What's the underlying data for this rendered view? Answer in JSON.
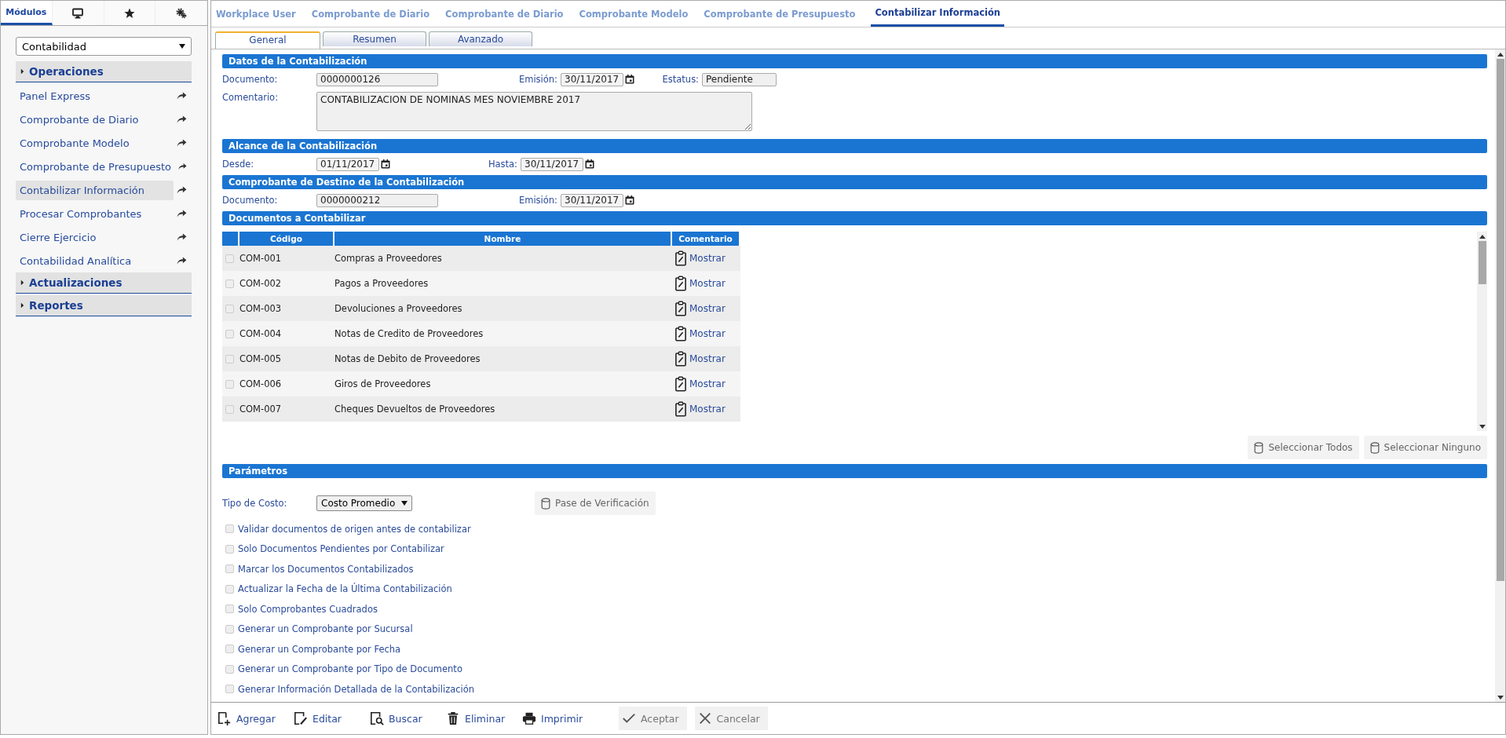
{
  "sidebar": {
    "tabs": [
      {
        "label": "Módulos",
        "selected": true
      },
      {
        "selected": false
      },
      {
        "selected": false
      },
      {
        "selected": false
      }
    ],
    "module_select": {
      "value": "Contabilidad"
    },
    "sections": [
      {
        "title": "Operaciones",
        "items": [
          {
            "label": "Panel Express",
            "selected": false
          },
          {
            "label": "Comprobante de Diario",
            "selected": false
          },
          {
            "label": "Comprobante Modelo",
            "selected": false
          },
          {
            "label": "Comprobante de Presupuesto",
            "selected": false
          },
          {
            "label": "Contabilizar Información",
            "selected": true
          },
          {
            "label": "Procesar Comprobantes",
            "selected": false
          },
          {
            "label": "Cierre Ejercicio",
            "selected": false
          },
          {
            "label": "Contabilidad Analítica",
            "selected": false
          }
        ]
      },
      {
        "title": "Actualizaciones"
      },
      {
        "title": "Reportes"
      }
    ]
  },
  "tabs": [
    {
      "label": "Workplace User",
      "selected": false
    },
    {
      "label": "Comprobante de Diario",
      "selected": false
    },
    {
      "label": "Comprobante de Diario",
      "selected": false
    },
    {
      "label": "Comprobante Modelo",
      "selected": false
    },
    {
      "label": "Comprobante de Presupuesto",
      "selected": false
    },
    {
      "label": "Contabilizar Información",
      "selected": true
    }
  ],
  "subtabs": [
    {
      "label": "General",
      "selected": true
    },
    {
      "label": "Resumen",
      "selected": false
    },
    {
      "label": "Avanzado",
      "selected": false
    }
  ],
  "datos": {
    "title": "Datos de la Contabilización",
    "documento": {
      "label": "Documento:",
      "value": "0000000126"
    },
    "emision": {
      "label": "Emisión:",
      "value": "30/11/2017"
    },
    "estatus": {
      "label": "Estatus:",
      "value": "Pendiente"
    },
    "comentario": {
      "label": "Comentario:",
      "value": "CONTABILIZACION DE NOMINAS MES NOVIEMBRE 2017"
    }
  },
  "alcance": {
    "title": "Alcance de la Contabilización",
    "desde": {
      "label": "Desde:",
      "value": "01/11/2017"
    },
    "hasta": {
      "label": "Hasta:",
      "value": "30/11/2017"
    }
  },
  "destino": {
    "title": "Comprobante de Destino de la Contabilización",
    "documento": {
      "label": "Documento:",
      "value": "0000000212"
    },
    "emision": {
      "label": "Emisión:",
      "value": "30/11/2017"
    }
  },
  "documentos": {
    "title": "Documentos a Contabilizar",
    "columns": [
      "Código",
      "Nombre",
      "Comentario"
    ],
    "rows": [
      {
        "checked": false,
        "code": "COM-001",
        "name": "Compras a Proveedores",
        "comment": "Mostrar"
      },
      {
        "checked": false,
        "code": "COM-002",
        "name": "Pagos a Proveedores",
        "comment": "Mostrar"
      },
      {
        "checked": false,
        "code": "COM-003",
        "name": "Devoluciones a Proveedores",
        "comment": "Mostrar"
      },
      {
        "checked": false,
        "code": "COM-004",
        "name": "Notas de Credito de Proveedores",
        "comment": "Mostrar"
      },
      {
        "checked": false,
        "code": "COM-005",
        "name": "Notas de Debito de Proveedores",
        "comment": "Mostrar"
      },
      {
        "checked": false,
        "code": "COM-006",
        "name": "Giros de Proveedores",
        "comment": "Mostrar"
      },
      {
        "checked": false,
        "code": "COM-007",
        "name": "Cheques Devueltos de Proveedores",
        "comment": "Mostrar"
      }
    ],
    "buttons": [
      "Seleccionar Todos",
      "Seleccionar Ninguno"
    ]
  },
  "parametros": {
    "title": "Parámetros",
    "tipo_costo": {
      "label": "Tipo de Costo:",
      "value": "Costo Promedio"
    },
    "verify_button": "Pase de Verificación",
    "options": [
      {
        "label": "Validar documentos de origen antes de contabilizar",
        "checked": false
      },
      {
        "label": "Solo Documentos Pendientes por Contabilizar",
        "checked": false
      },
      {
        "label": "Marcar los Documentos Contabilizados",
        "checked": false
      },
      {
        "label": "Actualizar la Fecha de la Última Contabilización",
        "checked": false
      },
      {
        "label": "Solo Comprobantes Cuadrados",
        "checked": false
      },
      {
        "label": "Generar un Comprobante por Sucursal",
        "checked": false
      },
      {
        "label": "Generar un Comprobante por Fecha",
        "checked": false
      },
      {
        "label": "Generar un Comprobante por Tipo de Documento",
        "checked": false
      },
      {
        "label": "Generar Información Detallada de la Contabilización",
        "checked": false
      }
    ]
  },
  "toolbar": [
    {
      "label": "Agregar",
      "disabled": false
    },
    {
      "label": "Editar",
      "disabled": false
    },
    {
      "label": "Buscar",
      "disabled": false
    },
    {
      "label": "Eliminar",
      "disabled": false
    },
    {
      "label": "Imprimir",
      "disabled": false
    },
    {
      "label": "Aceptar",
      "disabled": true
    },
    {
      "label": "Cancelar",
      "disabled": true
    }
  ]
}
